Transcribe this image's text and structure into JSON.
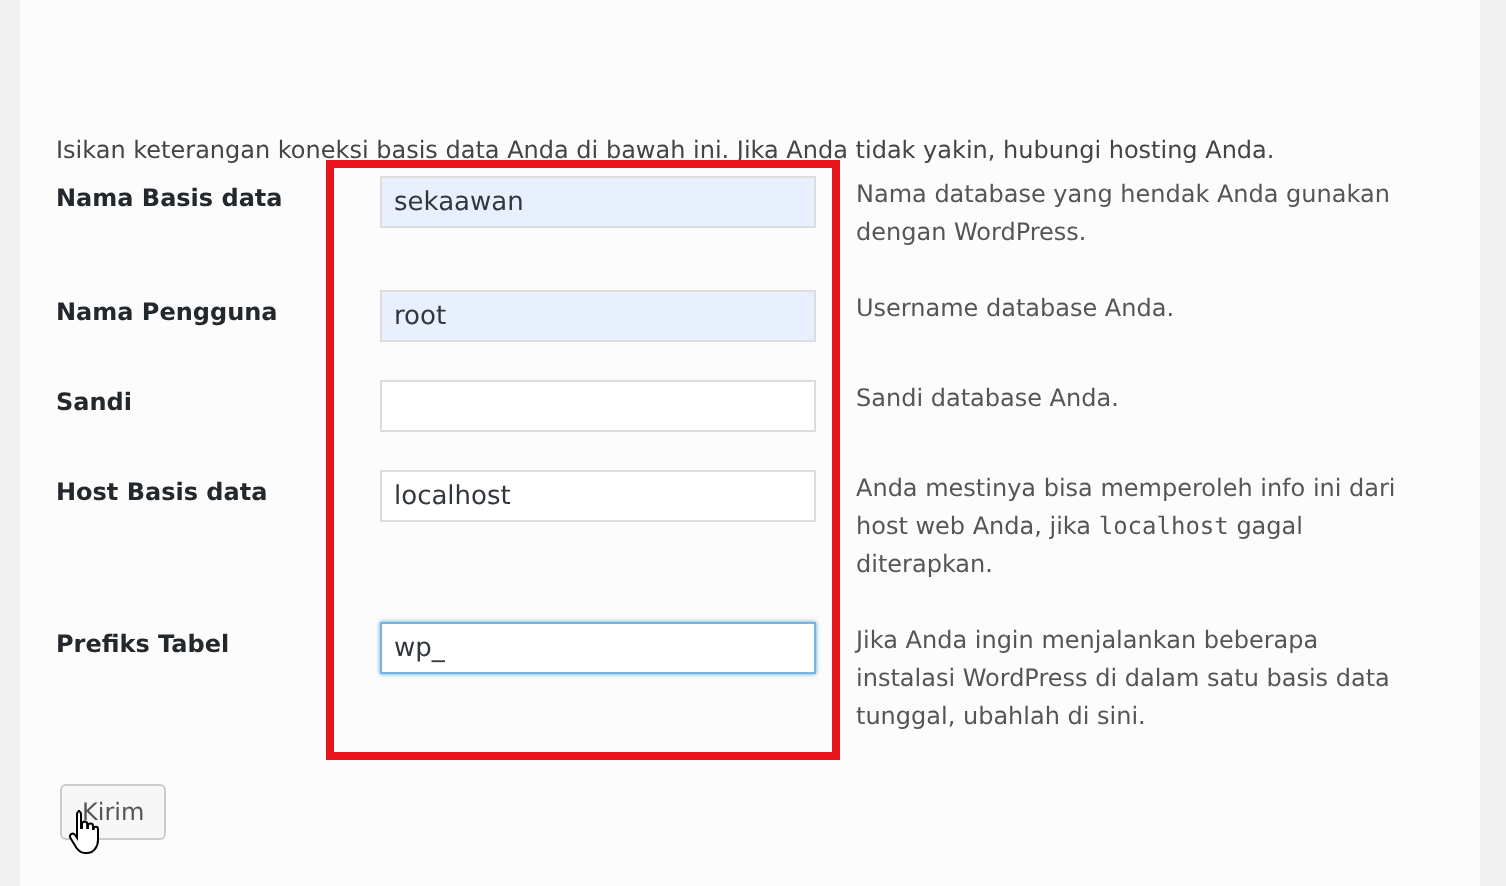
{
  "intro": "Isikan keterangan koneksi basis data Anda di bawah ini. Jika Anda tidak yakin, hubungi hosting Anda.",
  "fields": [
    {
      "label": "Nama Basis data",
      "value": "sekaawan",
      "autofilled": true,
      "focused": false,
      "description": [
        {
          "text": "Nama database yang hendak Anda gunakan dengan WordPress.",
          "code": false
        }
      ]
    },
    {
      "label": "Nama Pengguna",
      "value": "root",
      "autofilled": true,
      "focused": false,
      "description": [
        {
          "text": "Username database Anda.",
          "code": false
        }
      ]
    },
    {
      "label": "Sandi",
      "autofilled": false,
      "focused": false,
      "description": [
        {
          "text": "Sandi database Anda.",
          "code": false
        }
      ]
    },
    {
      "label": "Host Basis data",
      "value": "localhost",
      "autofilled": false,
      "focused": false,
      "description": [
        {
          "text": "Anda mestinya bisa memperoleh info ini dari host web Anda, jika ",
          "code": false
        },
        {
          "text": "localhost",
          "code": true
        },
        {
          "text": " gagal diterapkan.",
          "code": false
        }
      ]
    },
    {
      "label": "Prefiks Tabel",
      "value": "wp_",
      "autofilled": false,
      "focused": true,
      "description": [
        {
          "text": "Jika Anda ingin menjalankan beberapa instalasi WordPress di dalam satu basis data tunggal, ubahlah di sini.",
          "code": false
        }
      ]
    }
  ],
  "highlight_frame": true,
  "submit_button": "Kirim"
}
